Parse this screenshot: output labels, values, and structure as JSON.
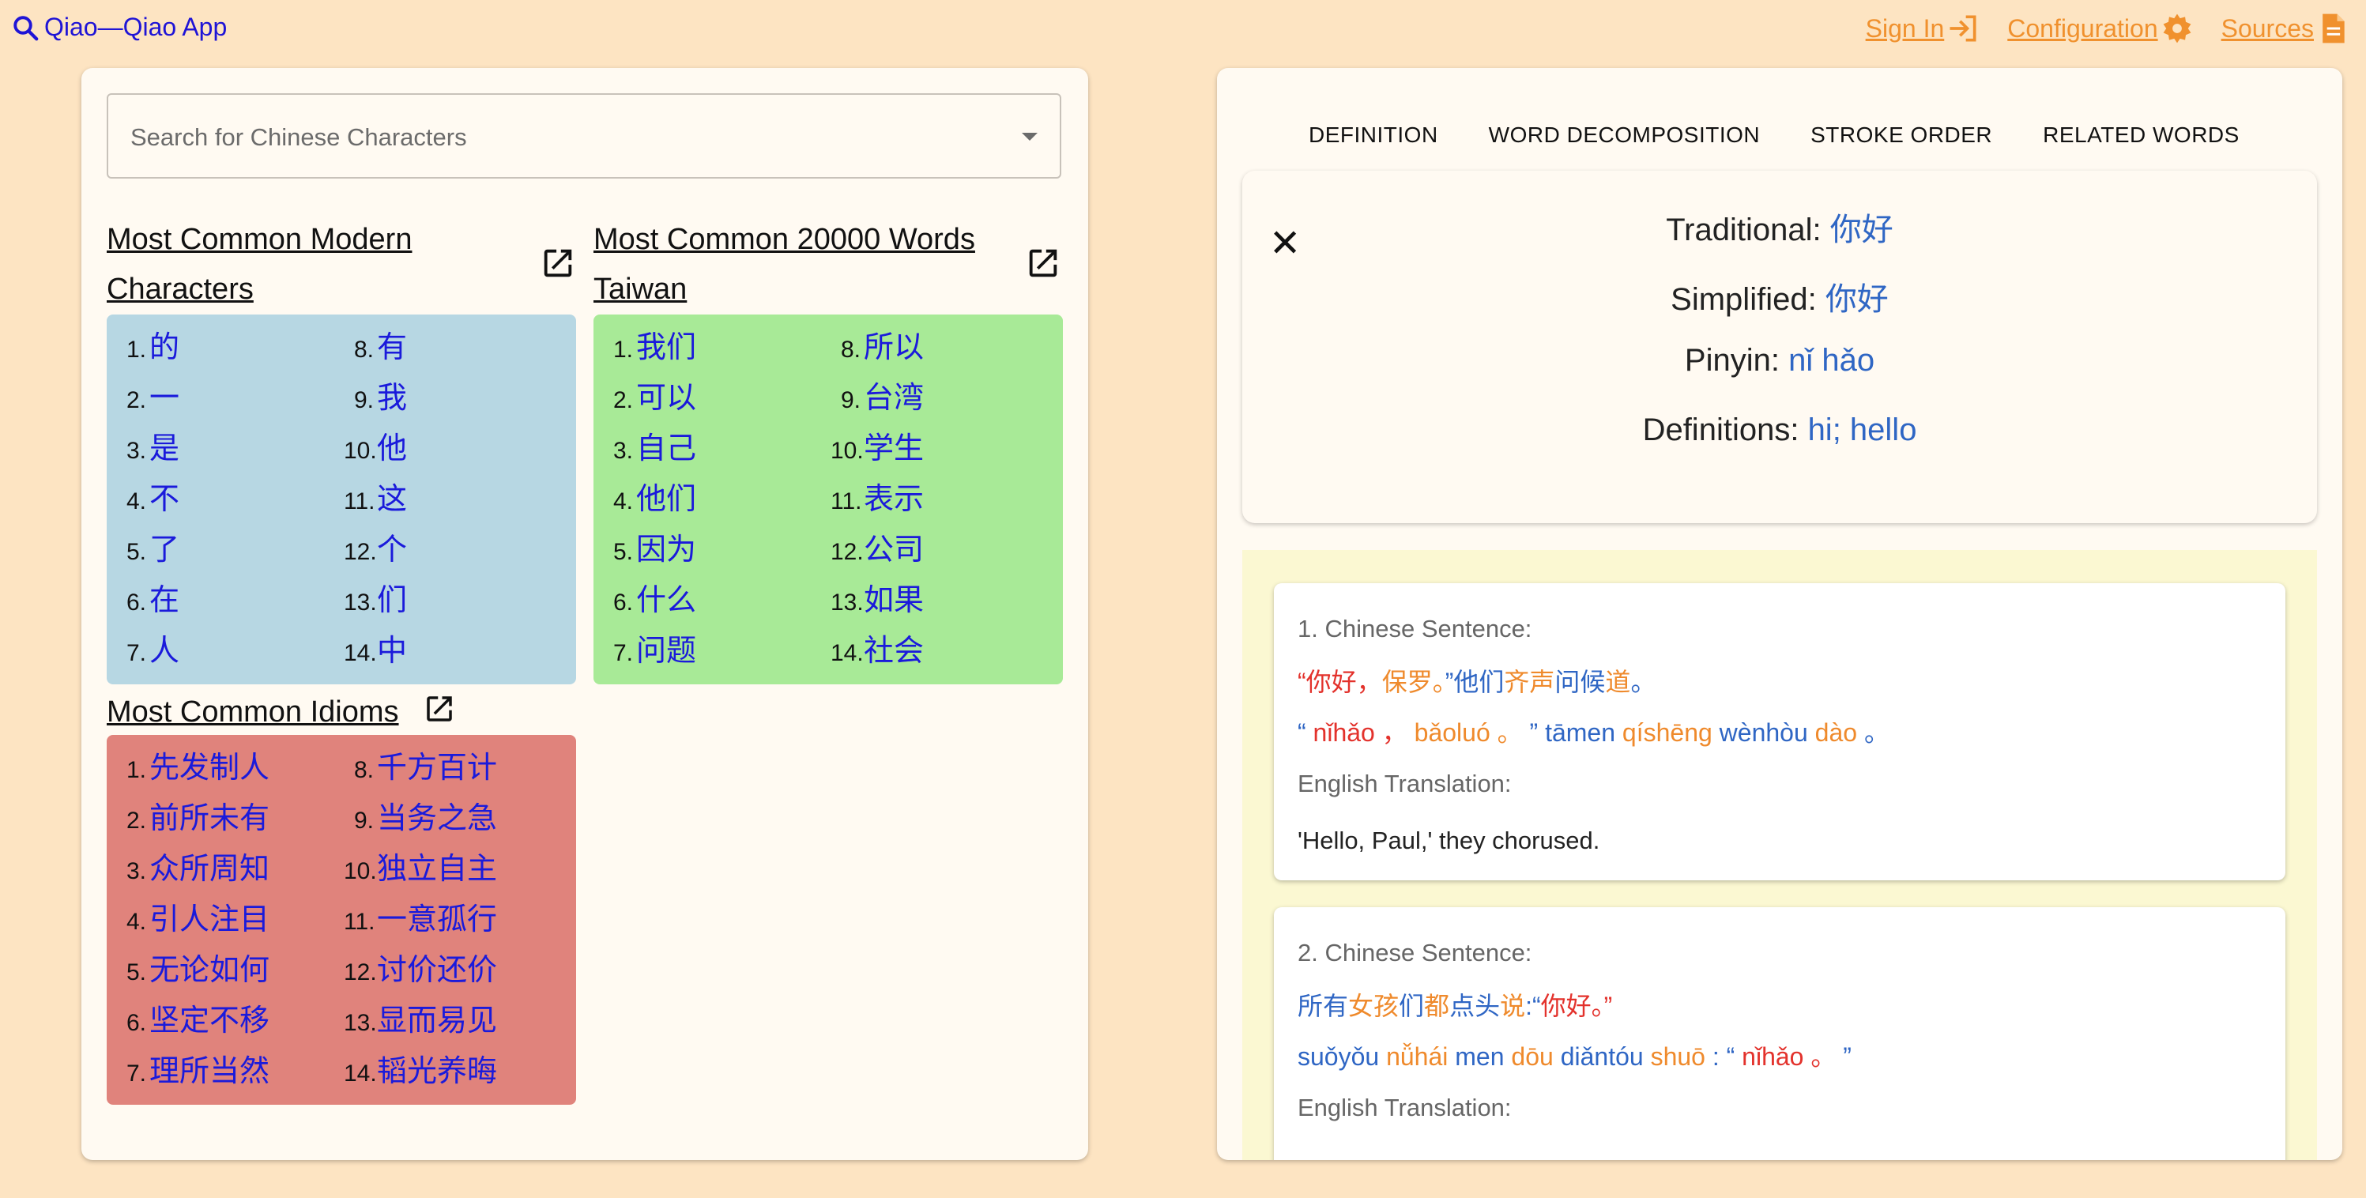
{
  "header": {
    "app_title": "Qiao—Qiao App",
    "signin_label": "Sign In",
    "config_label": "Configuration",
    "sources_label": "Sources"
  },
  "search": {
    "placeholder": "Search for Chinese Characters"
  },
  "lists": {
    "modern": {
      "title_1": "Most Common Modern",
      "title_2": "Characters",
      "col1": [
        {
          "n": "1.",
          "w": "的"
        },
        {
          "n": "2.",
          "w": "一"
        },
        {
          "n": "3.",
          "w": "是"
        },
        {
          "n": "4.",
          "w": "不"
        },
        {
          "n": "5.",
          "w": "了"
        },
        {
          "n": "6.",
          "w": "在"
        },
        {
          "n": "7.",
          "w": "人"
        }
      ],
      "col2": [
        {
          "n": "8.",
          "w": "有"
        },
        {
          "n": "9.",
          "w": "我"
        },
        {
          "n": "10.",
          "w": "他"
        },
        {
          "n": "11.",
          "w": "这"
        },
        {
          "n": "12.",
          "w": "个"
        },
        {
          "n": "13.",
          "w": "们"
        },
        {
          "n": "14.",
          "w": "中"
        }
      ]
    },
    "words": {
      "title_1": "Most Common 20000 Words",
      "title_2": "Taiwan",
      "col1": [
        {
          "n": "1.",
          "w": "我们"
        },
        {
          "n": "2.",
          "w": "可以"
        },
        {
          "n": "3.",
          "w": "自己"
        },
        {
          "n": "4.",
          "w": "他们"
        },
        {
          "n": "5.",
          "w": "因为"
        },
        {
          "n": "6.",
          "w": "什么"
        },
        {
          "n": "7.",
          "w": "问题"
        }
      ],
      "col2": [
        {
          "n": "8.",
          "w": "所以"
        },
        {
          "n": "9.",
          "w": "台湾"
        },
        {
          "n": "10.",
          "w": "学生"
        },
        {
          "n": "11.",
          "w": "表示"
        },
        {
          "n": "12.",
          "w": "公司"
        },
        {
          "n": "13.",
          "w": "如果"
        },
        {
          "n": "14.",
          "w": "社会"
        }
      ]
    },
    "idioms": {
      "title_1": "Most Common Idioms",
      "col1": [
        {
          "n": "1.",
          "w": "先发制人"
        },
        {
          "n": "2.",
          "w": "前所未有"
        },
        {
          "n": "3.",
          "w": "众所周知"
        },
        {
          "n": "4.",
          "w": "引人注目"
        },
        {
          "n": "5.",
          "w": "无论如何"
        },
        {
          "n": "6.",
          "w": "坚定不移"
        },
        {
          "n": "7.",
          "w": "理所当然"
        }
      ],
      "col2": [
        {
          "n": "8.",
          "w": "千方百计"
        },
        {
          "n": "9.",
          "w": "当务之急"
        },
        {
          "n": "10.",
          "w": "独立自主"
        },
        {
          "n": "11.",
          "w": "一意孤行"
        },
        {
          "n": "12.",
          "w": "讨价还价"
        },
        {
          "n": "13.",
          "w": "显而易见"
        },
        {
          "n": "14.",
          "w": "韬光养晦"
        }
      ]
    }
  },
  "tabs": [
    "DEFINITION",
    "WORD DECOMPOSITION",
    "STROKE ORDER",
    "RELATED WORDS"
  ],
  "definition": {
    "close_glyph": "✕",
    "traditional_label": "Traditional:",
    "traditional_value": "你好",
    "simplified_label": "Simplified:",
    "simplified_value": "你好",
    "pinyin_label": "Pinyin:",
    "pinyin_value": "nǐ hǎo",
    "definitions_label": "Definitions:",
    "definitions_value": "hi; hello"
  },
  "examples": [
    {
      "heading": "1. Chinese Sentence:",
      "hanzi": [
        {
          "t": "“你好",
          "c": "red"
        },
        {
          "t": "，",
          "c": "red"
        },
        {
          "t": "保罗",
          "c": "org"
        },
        {
          "t": "。",
          "c": "org"
        },
        {
          "t": "”",
          "c": "blu"
        },
        {
          "t": "他们",
          "c": "blu"
        },
        {
          "t": "齐声",
          "c": "org"
        },
        {
          "t": "问候",
          "c": "blu"
        },
        {
          "t": "道",
          "c": "org"
        },
        {
          "t": "。",
          "c": "blu"
        }
      ],
      "pinyin": [
        {
          "t": "“ ",
          "c": "blu"
        },
        {
          "t": "nǐhǎo ，  ",
          "c": "red"
        },
        {
          "t": "bǎoluó  。  ",
          "c": "org"
        },
        {
          "t": "” tāmen ",
          "c": "blu"
        },
        {
          "t": "qíshēng ",
          "c": "org"
        },
        {
          "t": "wènhòu ",
          "c": "blu"
        },
        {
          "t": "dào ",
          "c": "org"
        },
        {
          "t": " 。",
          "c": "blu"
        }
      ],
      "translation_label": "English Translation:",
      "translation": "'Hello, Paul,' they chorused."
    },
    {
      "heading": "2. Chinese Sentence:",
      "hanzi": [
        {
          "t": "所有",
          "c": "blu"
        },
        {
          "t": "女孩",
          "c": "org"
        },
        {
          "t": "们",
          "c": "blu"
        },
        {
          "t": "都",
          "c": "org"
        },
        {
          "t": "点头",
          "c": "blu"
        },
        {
          "t": "说",
          "c": "org"
        },
        {
          "t": ":“",
          "c": "blu"
        },
        {
          "t": "你好",
          "c": "red"
        },
        {
          "t": "。”",
          "c": "red"
        }
      ],
      "pinyin": [
        {
          "t": "suǒyǒu ",
          "c": "blu"
        },
        {
          "t": "nǚhái ",
          "c": "org"
        },
        {
          "t": "men ",
          "c": "blu"
        },
        {
          "t": "dōu ",
          "c": "org"
        },
        {
          "t": "diǎntóu ",
          "c": "blu"
        },
        {
          "t": "shuō ",
          "c": "org"
        },
        {
          "t": ": “ ",
          "c": "blu"
        },
        {
          "t": "nǐhǎo  。",
          "c": "red"
        },
        {
          "t": "  ”",
          "c": "blu"
        }
      ],
      "translation_label": "English Translation:",
      "translation": ""
    }
  ]
}
